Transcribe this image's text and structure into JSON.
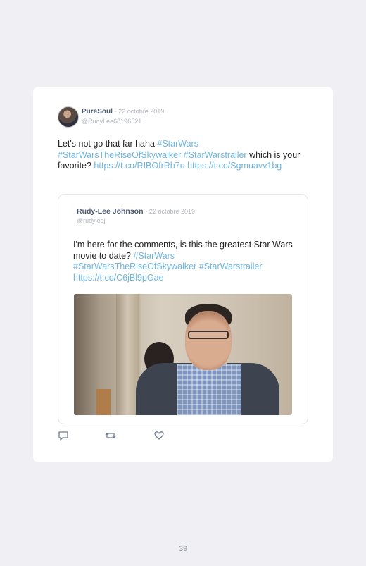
{
  "tweet": {
    "author_name": "PureSoul",
    "date": "· 22 octobre 2019",
    "handle": "@RudyLee68196521",
    "text_parts": [
      "Let's not go that far haha ",
      "#StarWars",
      " ",
      "#StarWarsTheRiseOfSkywalker",
      " ",
      "#StarWarstrailer",
      " which is your favorite? ",
      "https://t.co/RIBOfrRh7u",
      " ",
      "https://t.co/Sgmuavv1bg"
    ]
  },
  "quoted_tweet": {
    "author_name": "Rudy-Lee Johnson",
    "date": "· 22 octobre 2019",
    "handle": "@rudyleej",
    "text_parts": [
      "I'm here for the comments, is this the greatest Star Wars movie to date? ",
      "#StarWars",
      " ",
      "#StarWarsTheRiseOfSkywalker",
      " ",
      "#StarWarstrailer",
      " ",
      "https://t.co/C6jBl9pGae"
    ]
  },
  "actions": {
    "reply_icon": "reply-icon",
    "retweet_icon": "retweet-icon",
    "like_icon": "heart-icon"
  },
  "colors": {
    "background": "#f0f0f4",
    "card": "#ffffff",
    "link": "#6fb6e3",
    "author": "#4b5a72",
    "meta": "#b0b4bc"
  },
  "page_number": "39"
}
